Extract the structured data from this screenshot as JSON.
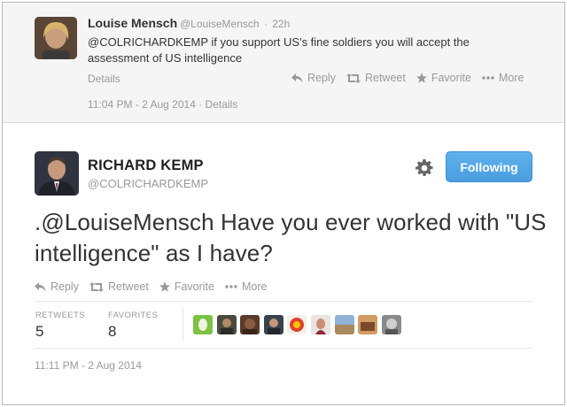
{
  "parent_tweet": {
    "name": "Louise Mensch",
    "handle": "@LouiseMensch",
    "age": "22h",
    "text": "@COLRICHARDKEMP if you support US's fine soldiers you will accept the assessment of US intelligence",
    "details": "Details",
    "actions": {
      "reply": "Reply",
      "retweet": "Retweet",
      "favorite": "Favorite",
      "more": "More"
    },
    "timestamp": "11:04 PM - 2 Aug 2014 · Details"
  },
  "main_tweet": {
    "name": "RICHARD KEMP",
    "handle": "@COLRICHARDKEMP",
    "follow_label": "Following",
    "text": ".@LouiseMensch Have you ever worked with \"US intelligence\" as I have?",
    "actions": {
      "reply": "Reply",
      "retweet": "Retweet",
      "favorite": "Favorite",
      "more": "More"
    },
    "stats": {
      "retweets_label": "RETWEETS",
      "retweets": "5",
      "favorites_label": "FAVORITES",
      "favorites": "8"
    },
    "timestamp": "11:11 PM - 2 Aug 2014"
  },
  "colors": {
    "accent": "#55a8e6",
    "muted_text": "#999999",
    "parent_bg": "#f5f5f5"
  },
  "icons": [
    "reply-icon",
    "retweet-icon",
    "favorite-star-icon",
    "more-dots-icon",
    "gear-icon"
  ]
}
